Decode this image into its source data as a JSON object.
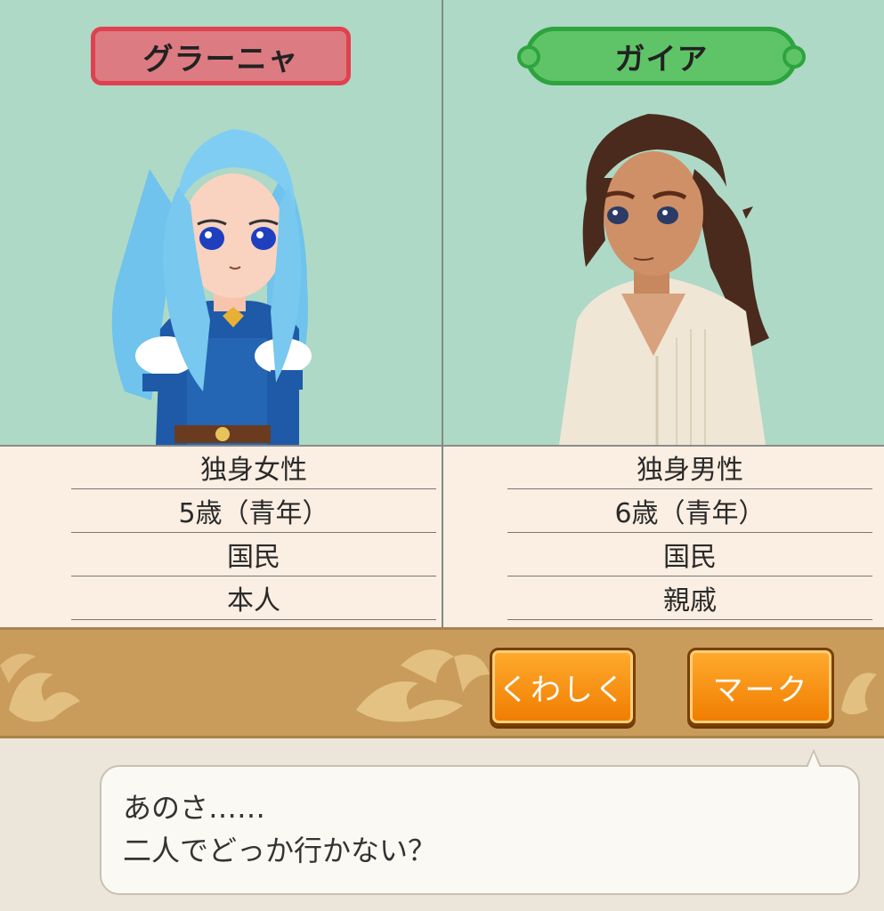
{
  "left_character": {
    "name": "グラーニャ",
    "info": [
      "独身女性",
      "5歳（青年）",
      "国民",
      "本人"
    ]
  },
  "right_character": {
    "name": "ガイア",
    "info": [
      "独身男性",
      "6歳（青年）",
      "国民",
      "親戚"
    ]
  },
  "actions": {
    "detail_label": "くわしく",
    "mark_label": "マーク"
  },
  "dialog": {
    "line1": "あのさ……",
    "line2": "二人でどっか行かない？"
  },
  "colors": {
    "panel_bg": "#aed9c6",
    "left_plate": "#dd7b82",
    "right_plate": "#5fc467",
    "button": "#f59a1a",
    "action_bar": "#c99c5c"
  }
}
